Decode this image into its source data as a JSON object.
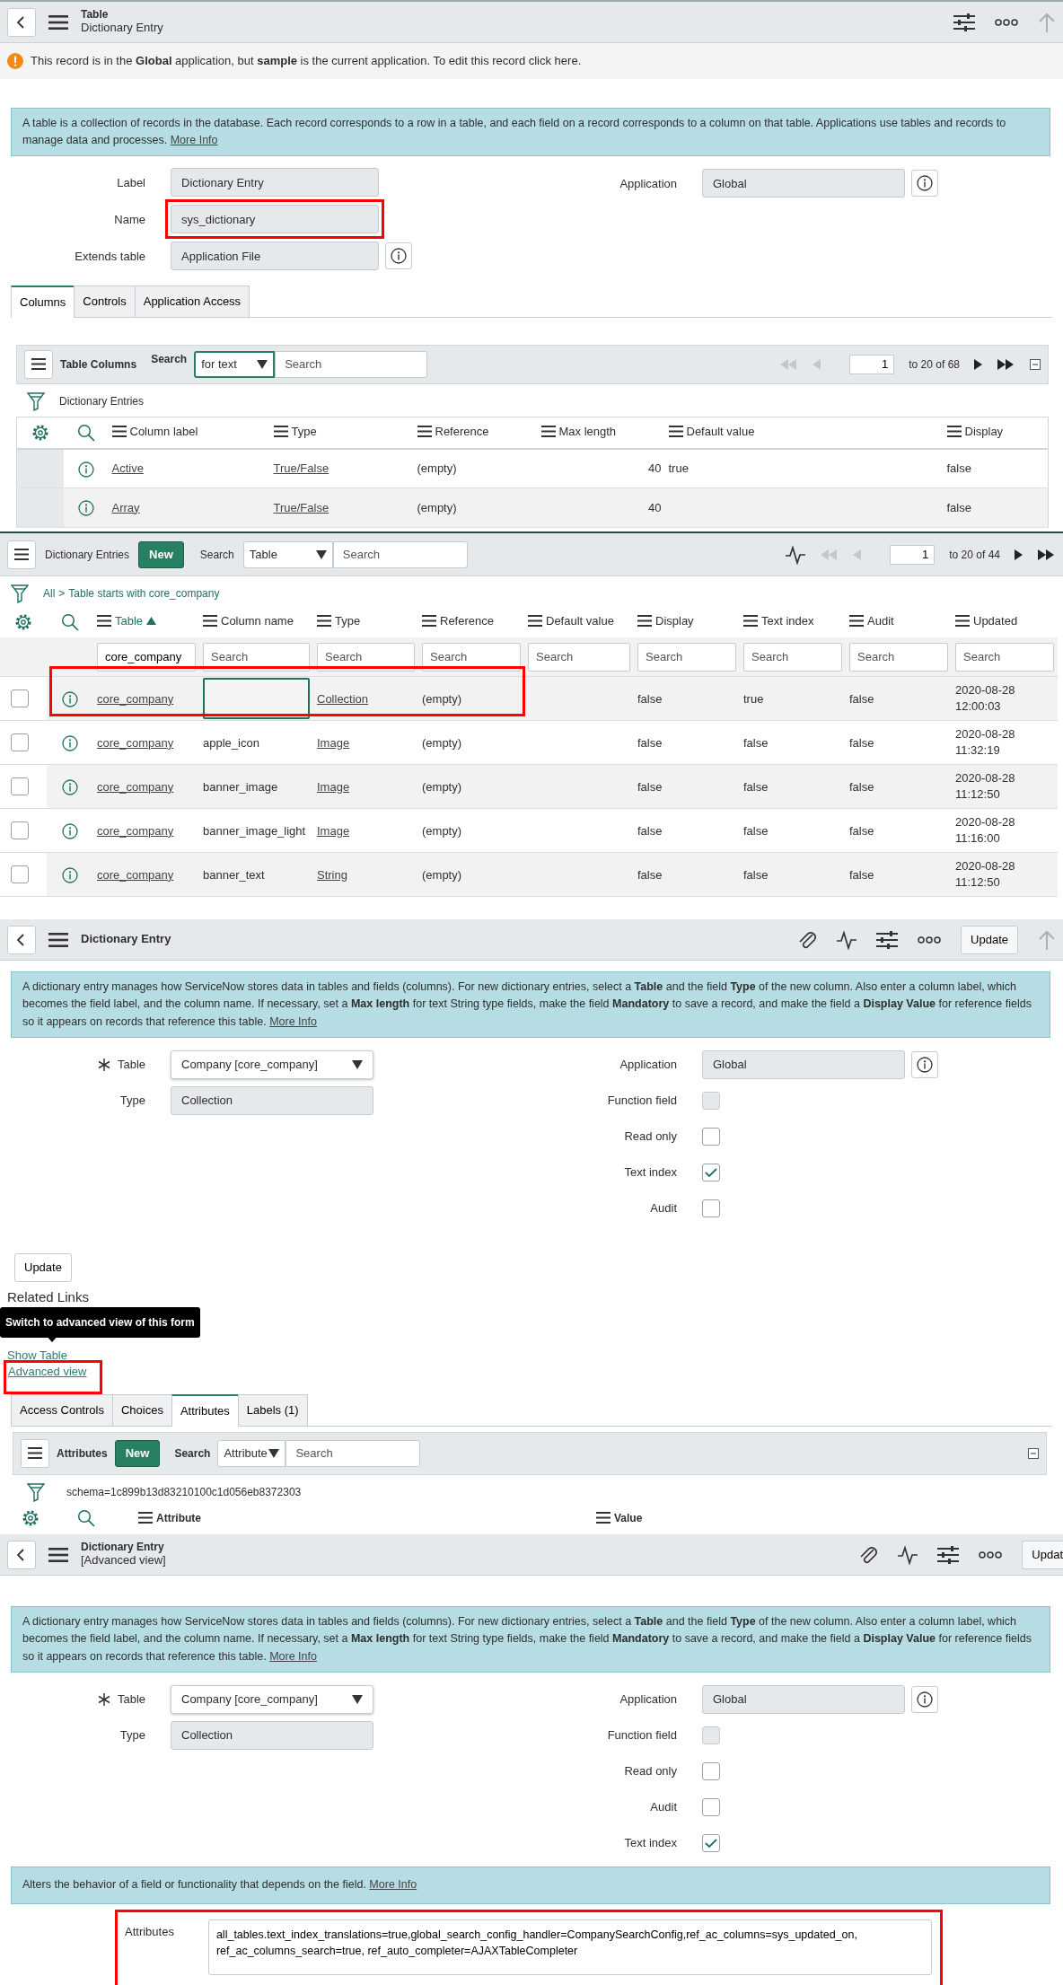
{
  "table_form": {
    "header": {
      "title": "Table",
      "subtitle": "Dictionary Entry"
    },
    "notice": "This record is in the **Global** application, but **sample** is the current application. To edit this record click here.",
    "info": {
      "text": "A table is a collection of records in the database. Each record corresponds to a row in a table, and each field on a record corresponds to a column on that table. Applications use tables and records to manage data and processes.",
      "link": "More Info"
    },
    "fields_left": [
      {
        "label": "Label",
        "value": "Dictionary Entry",
        "highlighted": false,
        "info_button": false
      },
      {
        "label": "Name",
        "value": "sys_dictionary",
        "highlighted": true,
        "info_button": false
      },
      {
        "label": "Extends table",
        "value": "Application File",
        "highlighted": false,
        "info_button": true
      }
    ],
    "application": {
      "label": "Application",
      "value": "Global"
    },
    "tabs": [
      {
        "label": "Columns",
        "selected": true
      },
      {
        "label": "Controls",
        "selected": false
      },
      {
        "label": "Application Access",
        "selected": false
      }
    ],
    "list": {
      "title": "Table Columns",
      "search_label": "Search",
      "search_by": "for text",
      "search_placeholder": "Search",
      "page": "1",
      "range": "to 20 of 68",
      "filter": "Dictionary Entries",
      "columns": [
        "Column label",
        "Type",
        "Reference",
        "Max length",
        "Default value",
        "Display"
      ],
      "rows": [
        {
          "label": "Active",
          "type": "True/False",
          "reference": "(empty)",
          "max_length": "40",
          "default_value": "true",
          "display": "false"
        },
        {
          "label": "Array",
          "type": "True/False",
          "reference": "(empty)",
          "max_length": "40",
          "display": "false"
        }
      ]
    }
  },
  "dictionary_list": {
    "title": "Dictionary Entries",
    "new_button": "New",
    "search_label": "Search",
    "search_by": "Table",
    "search_placeholder": "Search",
    "page": "1",
    "range": "to 20 of 44",
    "breadcrumb": {
      "all": "All",
      "separator": ">",
      "filter": "Table starts with core_company"
    },
    "columns": [
      {
        "label": "Table",
        "sorted": true,
        "filter_value": "core_company"
      },
      {
        "label": "Column name",
        "sorted": false,
        "filter_placeholder": "Search"
      },
      {
        "label": "Type",
        "sorted": false,
        "filter_placeholder": "Search"
      },
      {
        "label": "Reference",
        "sorted": false,
        "filter_placeholder": "Search"
      },
      {
        "label": "Default value",
        "sorted": false,
        "filter_placeholder": "Search"
      },
      {
        "label": "Display",
        "sorted": false,
        "filter_placeholder": "Search"
      },
      {
        "label": "Text index",
        "sorted": false,
        "filter_placeholder": "Search"
      },
      {
        "label": "Audit",
        "sorted": false,
        "filter_placeholder": "Search"
      },
      {
        "label": "Updated",
        "sorted": false,
        "filter_placeholder": "Search"
      }
    ],
    "rows": [
      {
        "selected": false,
        "highlighted": true,
        "editing": true,
        "table": "core_company",
        "type": "Collection",
        "reference": "(empty)",
        "display": "false",
        "text_index": "true",
        "audit": "false",
        "updated": "2020-08-28 12:00:03"
      },
      {
        "selected": false,
        "highlighted": false,
        "editing": false,
        "table": "core_company",
        "column_name": "apple_icon",
        "type": "Image",
        "reference": "(empty)",
        "display": "false",
        "text_index": "false",
        "audit": "false",
        "updated": "2020-08-28 11:32:19"
      },
      {
        "selected": false,
        "highlighted": false,
        "editing": false,
        "table": "core_company",
        "column_name": "banner_image",
        "type": "Image",
        "reference": "(empty)",
        "display": "false",
        "text_index": "false",
        "audit": "false",
        "updated": "2020-08-28 11:12:50"
      },
      {
        "selected": false,
        "highlighted": false,
        "editing": false,
        "table": "core_company",
        "column_name": "banner_image_light",
        "type": "Image",
        "reference": "(empty)",
        "display": "false",
        "text_index": "false",
        "audit": "false",
        "updated": "2020-08-28 11:16:00"
      },
      {
        "selected": false,
        "highlighted": false,
        "editing": false,
        "table": "core_company",
        "column_name": "banner_text",
        "type": "String",
        "reference": "(empty)",
        "display": "false",
        "text_index": "false",
        "audit": "false",
        "updated": "2020-08-28 11:12:50"
      }
    ]
  },
  "entry_form": {
    "header": {
      "title": "Dictionary Entry",
      "update_button": "Update"
    },
    "info": {
      "text": "A dictionary entry manages how ServiceNow stores data in tables and fields (columns). For new dictionary entries, select a **Table** and the field **Type** of the new column. Also enter a column label, which becomes the field label, and the column name. If necessary, set a **Max length** for text String type fields, make the field **Mandatory** to save a record, and make the field a **Display Value** for reference fields so it appears on records that reference this table.",
      "link": "More Info"
    },
    "fields_left": [
      {
        "kind": "select",
        "label": "Table",
        "value": "Company [core_company]",
        "required": true
      },
      {
        "kind": "readonly",
        "label": "Type",
        "value": "Collection",
        "required": false
      }
    ],
    "application": {
      "label": "Application",
      "value": "Global"
    },
    "checks": [
      {
        "label": "Function field",
        "checked": false,
        "disabled": true
      },
      {
        "label": "Read only",
        "checked": false,
        "disabled": false
      },
      {
        "label": "Text index",
        "checked": true,
        "disabled": false
      },
      {
        "label": "Audit",
        "checked": false,
        "disabled": false
      }
    ],
    "bottom_button": "Update",
    "related_links": {
      "title": "Related Links",
      "links": [
        {
          "label": "Show Table",
          "highlighted": false
        },
        {
          "label": "Advanced view",
          "highlighted": true
        }
      ]
    },
    "tooltip": "Switch to advanced view of this form",
    "tabs": [
      {
        "label": "Access Controls",
        "selected": false
      },
      {
        "label": "Choices",
        "selected": false
      },
      {
        "label": "Attributes",
        "selected": true
      },
      {
        "label": "Labels (1)",
        "selected": false
      }
    ],
    "list": {
      "title": "Attributes",
      "new_button": "New",
      "search_label": "Search",
      "search_by": "Attribute",
      "search_placeholder": "Search",
      "filter": "schema=1c899b13d83210100c1d056eb8372303",
      "columns": [
        "Attribute",
        "Value"
      ]
    }
  },
  "advanced_form": {
    "header": {
      "title": "Dictionary Entry",
      "subtitle": "[Advanced view]",
      "update_button": "Updat"
    },
    "info": {
      "text": "A dictionary entry manages how ServiceNow stores data in tables and fields (columns). For new dictionary entries, select a **Table** and the field **Type** of the new column. Also enter a column label, which becomes the field label, and the column name. If necessary, set a **Max length** for text String type fields, make the field **Mandatory** to save a record, and make the field a **Display Value** for reference fields so it appears on records that reference this table.",
      "link": "More Info"
    },
    "fields_left": [
      {
        "kind": "select",
        "label": "Table",
        "value": "Company [core_company]",
        "required": true
      },
      {
        "kind": "readonly",
        "label": "Type",
        "value": "Collection",
        "required": false
      }
    ],
    "application": {
      "label": "Application",
      "value": "Global"
    },
    "checks": [
      {
        "label": "Function field",
        "checked": false,
        "disabled": true
      },
      {
        "label": "Read only",
        "checked": false,
        "disabled": false
      },
      {
        "label": "Audit",
        "checked": false,
        "disabled": false
      },
      {
        "label": "Text index",
        "checked": true,
        "disabled": false
      }
    ],
    "attributes_info": {
      "text": "Alters the behavior of a field or functionality that depends on the field.",
      "link": "More Info"
    },
    "attributes": {
      "label": "Attributes",
      "value": "all_tables.text_index_translations=true,global_search_config_handler=CompanySearchConfig,ref_ac_columns=sys_updated_on, ref_ac_columns_search=true, ref_auto_completer=AJAXTableCompleter",
      "highlighted": true
    }
  }
}
